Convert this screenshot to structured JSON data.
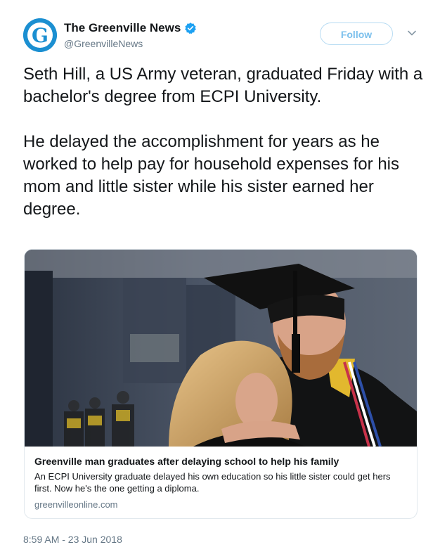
{
  "account": {
    "display_name": "The Greenville News",
    "handle": "@GreenvilleNews",
    "avatar_letter": "G",
    "verified": true
  },
  "follow_button": {
    "label": "Follow"
  },
  "menu": {
    "icon": "chevron-down-icon"
  },
  "tweet": {
    "paragraphs": [
      "Seth Hill, a US Army veteran, graduated Friday with a bachelor's degree from ECPI University.",
      "He delayed the accomplishment for years as he worked to help pay for household expenses for his mom and little sister while his sister earned her degree."
    ]
  },
  "card": {
    "title": "Greenville man graduates after delaying school to help his family",
    "description": "An ECPI University graduate delayed his own education so his little sister could get hers first. Now he's the one getting a diploma.",
    "domain": "greenvilleonline.com"
  },
  "timestamp": "8:59 AM - 23 Jun 2018",
  "colors": {
    "brand_blue": "#1b8fd1",
    "follow_text": "#7cc0ec",
    "verified": "#1da1f2",
    "muted": "#657786"
  }
}
